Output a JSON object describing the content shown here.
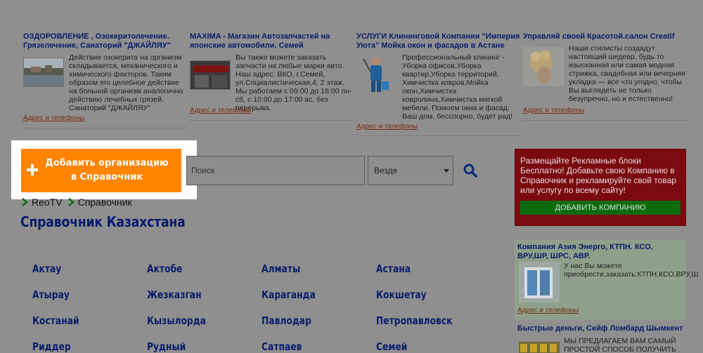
{
  "ads": [
    {
      "title": "ОЗДОРОВЛЕНИЕ , Озокеритолечение. Грязелечение, Санаторий \"ДЖАЙЛЯУ\"",
      "text": "Действие озокерита на организм складывается, механического и химического факторов. Таким образом его целебное действие на больной организм аналогично действию лечебных грязей. Санаторий \"ДЖАЙЛЯУ\"",
      "link": "Адрес и телефоны",
      "thumb_icon": "lakeside-photo"
    },
    {
      "title": "MAXIMA - Магазин Автозапчастей на японские автомобили. Семей",
      "text": "Вы также можете заказать запчасти на любые марки авто. Наш адрес: ВКО, г.Семей, ул.Социалистическая,4, 2 этаж. Мы работаем с 09:00 до 18:00 пн-сб, с 10:00 до 17:00 вс, без перерыва.",
      "link": "Адрес и телефоны",
      "thumb_icon": "shop-photo"
    },
    {
      "title": "УСЛУГИ Клининговой Компании \"Империя Уюта\" Мойка окон и фасадов в Астане",
      "text": "Профессиональный клининг - Уборка офисов,Уборка квартир,Уборка территорий, Химчистка ковров,Мойка окон,Химчистка ковролина,Химчистка мягкой мебели. Помоем окна и фасад: Ваш дом, бесспорно, будет рад!",
      "link": "Адрес и телефоны",
      "thumb_icon": "cleaner-photo"
    },
    {
      "title": "Управляй своей Красотой.салон Creatif",
      "text": "Наши стилисты создадут настоящий шедевр, будь то изысканная или самая модная стрижка, свадебная или вечерняя укладка — все что угодно, чтобы Вы выглядеть не только безупречно, но и естественно!",
      "link": "Адрес и телефоны",
      "thumb_icon": "hairstyle-photo"
    }
  ],
  "add_org_button": "Добавить организацию в Справочник",
  "search": {
    "placeholder": "Поиск",
    "scope": "Везде"
  },
  "breadcrumbs": [
    "ReoTV",
    "Справочник"
  ],
  "page_title": "Справочник Казахстана",
  "cities": [
    [
      "Актау",
      "Актобе",
      "Алматы",
      "Астана"
    ],
    [
      "Атырау",
      "Жезказган",
      "Караганда",
      "Кокшетау"
    ],
    [
      "Костанай",
      "Кызылорда",
      "Павлодар",
      "Петропавловск"
    ],
    [
      "Риддер",
      "Рудный",
      "Сатпаев",
      "Семей"
    ]
  ],
  "promo": {
    "text": "Размещайте Рекламные блоки Бесплатно! Добавьте свою Компанию в Справочник и рекламируйте свой товар или услугу по всему сайту!",
    "button": "ДОБАВИТЬ КОМПАНИЮ"
  },
  "side_ads": [
    {
      "title": "Компания Азия Энерго, КТПН. КСО, ВРУ,ШР, ШРС, АВР.",
      "text": "У нас Вы можете приобрести,заказать:КТПН,КСО,ВРУ,Ш",
      "link": "Адрес и телефоны"
    },
    {
      "title": "Быстрые деньги, Сейф Ломбард Шымкент",
      "text": "МЫ ПРЕДЛАГАЕМ ВАМ САМЫЙ ПРОСТОЙ СПОСОБ ПОЛУЧИТЬ"
    }
  ],
  "colors": {
    "accent_orange": "#ff8400",
    "promo_red": "#7a0a0f",
    "promo_green": "#0a6b0e",
    "link_blue": "#0b1c6b"
  }
}
